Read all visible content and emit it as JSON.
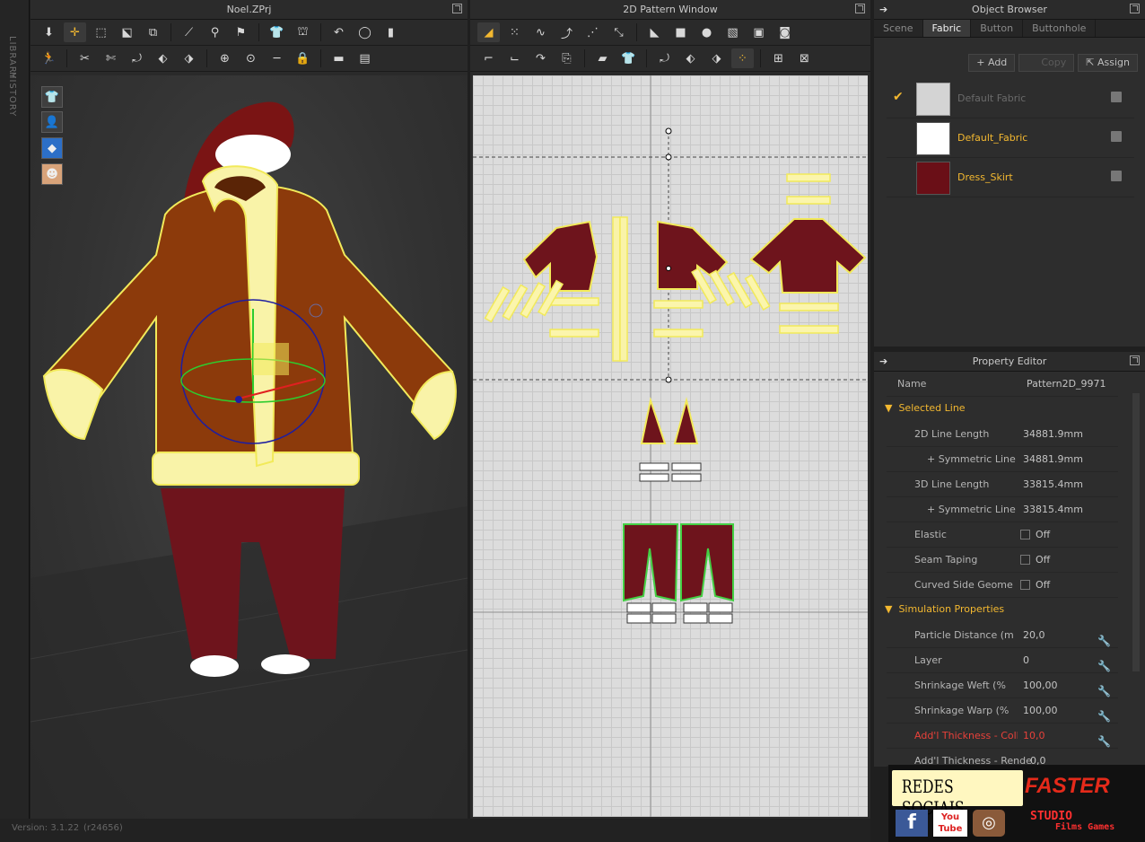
{
  "sidebar": {
    "library": "LIBRARY",
    "history": "HISTORY"
  },
  "panel3d": {
    "title": "Noel.ZPrj"
  },
  "panel2d": {
    "title": "2D Pattern Window"
  },
  "object_browser": {
    "title": "Object Browser",
    "tabs": [
      "Scene",
      "Fabric",
      "Button",
      "Buttonhole"
    ],
    "active_tab": "Fabric",
    "buttons": {
      "add": "Add",
      "copy": "Copy",
      "assign": "Assign"
    },
    "fabrics": [
      {
        "name": "Default Fabric",
        "color": "#d4d4d4",
        "checked": true
      },
      {
        "name": "Default_Fabric",
        "color": "#ffffff",
        "checked": false
      },
      {
        "name": "Dress_Skirt",
        "color": "#6a0f17",
        "checked": false
      }
    ]
  },
  "property_editor": {
    "title": "Property Editor",
    "name_label": "Name",
    "name_value": "Pattern2D_9971",
    "sections": {
      "selected_line": "Selected Line",
      "simulation": "Simulation Properties"
    },
    "rows": {
      "line2d": {
        "label": "2D Line Length",
        "value": "34881.9mm"
      },
      "sym2d": {
        "label": "+ Symmetric Line Le",
        "value": "34881.9mm"
      },
      "line3d": {
        "label": "3D Line Length",
        "value": "33815.4mm"
      },
      "sym3d": {
        "label": "+ Symmetric Line Le",
        "value": "33815.4mm"
      },
      "elastic": {
        "label": "Elastic",
        "value": "Off"
      },
      "seam": {
        "label": "Seam Taping",
        "value": "Off"
      },
      "curved": {
        "label": "Curved Side Geome",
        "value": "Off"
      },
      "particle": {
        "label": "Particle Distance (m",
        "value": "20,0"
      },
      "layer": {
        "label": "Layer",
        "value": "0"
      },
      "weft": {
        "label": "Shrinkage Weft (%",
        "value": "100,00"
      },
      "warp": {
        "label": "Shrinkage Warp (%",
        "value": "100,00"
      },
      "coll": {
        "label": "Add'l Thickness - Collisic",
        "value": "10,0"
      },
      "render": {
        "label": "Add'l Thickness - Render",
        "value": "0,0"
      }
    }
  },
  "social": {
    "title": "REDES SOCIAIS",
    "brand": "FASTER",
    "studio": "STUDIO",
    "sub": "Films Games",
    "youtube": "You Tube"
  },
  "status": {
    "version": "Version: 3.1.22",
    "build": "(r24656)"
  },
  "colors": {
    "accent": "#f3b830",
    "garment": "#8c3a0b",
    "fur": "#f9f3a8",
    "pants": "#6e141c"
  }
}
